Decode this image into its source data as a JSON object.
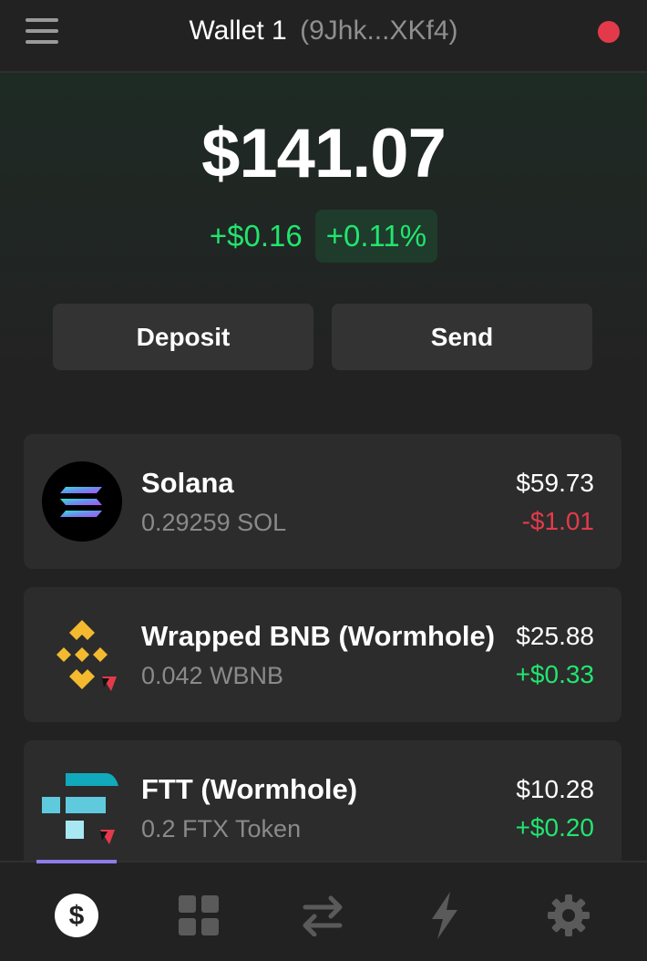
{
  "header": {
    "wallet_name": "Wallet 1",
    "wallet_address": "(9Jhk...XKf4)",
    "status_color": "#e33a4b"
  },
  "balance": {
    "total": "$141.07",
    "change_abs": "+$0.16",
    "change_pct": "+0.11%"
  },
  "actions": {
    "deposit_label": "Deposit",
    "send_label": "Send"
  },
  "tokens": [
    {
      "name": "Solana",
      "amount": "0.29259 SOL",
      "value": "$59.73",
      "change": "-$1.01",
      "icon": "solana-logo-icon"
    },
    {
      "name": "Wrapped BNB (Wormhole)",
      "amount": "0.042 WBNB",
      "value": "$25.88",
      "change": "+$0.33",
      "icon": "bnb-logo-icon"
    },
    {
      "name": "FTT (Wormhole)",
      "amount": "0.2 FTX Token",
      "value": "$10.28",
      "change": "+$0.20",
      "icon": "ftt-logo-icon"
    }
  ],
  "nav": {
    "active": "tokens",
    "items": [
      "dollar-icon",
      "grid-icon",
      "swap-arrows-icon",
      "lightning-icon",
      "gear-icon"
    ],
    "accent": "#8c7de8"
  },
  "colors": {
    "positive": "#21e56f",
    "negative": "#e33a4b"
  }
}
